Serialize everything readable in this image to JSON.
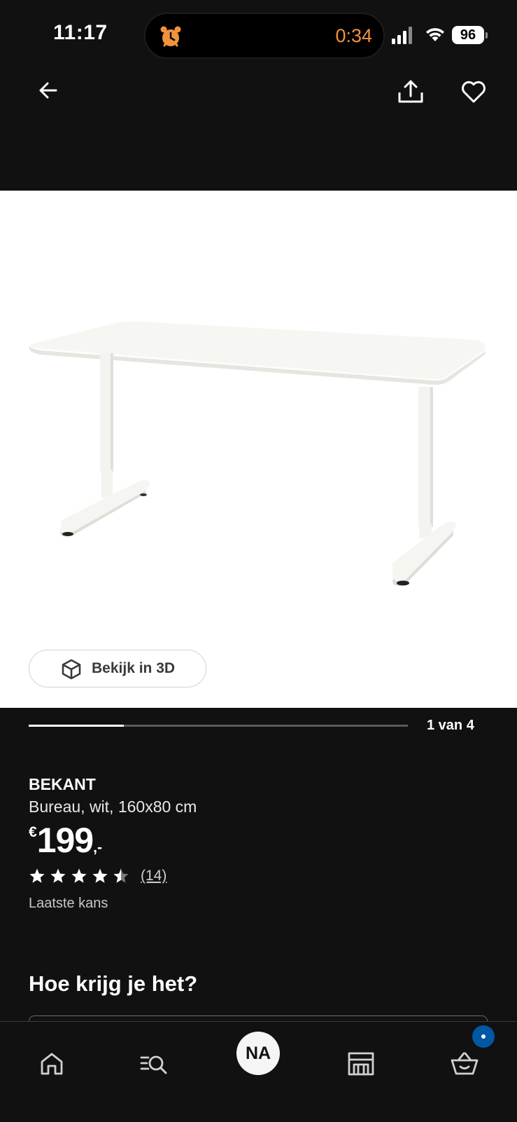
{
  "status_bar": {
    "time": "11:17",
    "timer": "0:34",
    "battery": "96"
  },
  "gallery": {
    "view_3d_label": "Bekijk in 3D",
    "page_counter": "1 van 4",
    "current_index": 1,
    "total": 4,
    "progress_fraction": 0.25
  },
  "product": {
    "name": "BEKANT",
    "description": "Bureau, wit, 160x80 cm",
    "price_currency": "€",
    "price_integer": "199",
    "price_decimal": ",-",
    "rating_value": 4.5,
    "rating_max": 5,
    "review_count": "(14)",
    "availability": "Laatste kans"
  },
  "sections": {
    "delivery_title": "Hoe krijg je het?"
  },
  "bottom_nav": {
    "profile_initials": "NA"
  },
  "colors": {
    "background": "#111111",
    "timer": "#f2923b",
    "cart_badge": "#0058a3"
  },
  "icons": {
    "status": [
      "alarm-icon",
      "signal-icon",
      "wifi-icon",
      "battery-icon"
    ],
    "header": [
      "back-arrow-icon",
      "share-icon",
      "heart-icon"
    ],
    "nav": [
      "home-icon",
      "search-list-icon",
      "profile-avatar",
      "store-icon",
      "cart-icon"
    ]
  }
}
